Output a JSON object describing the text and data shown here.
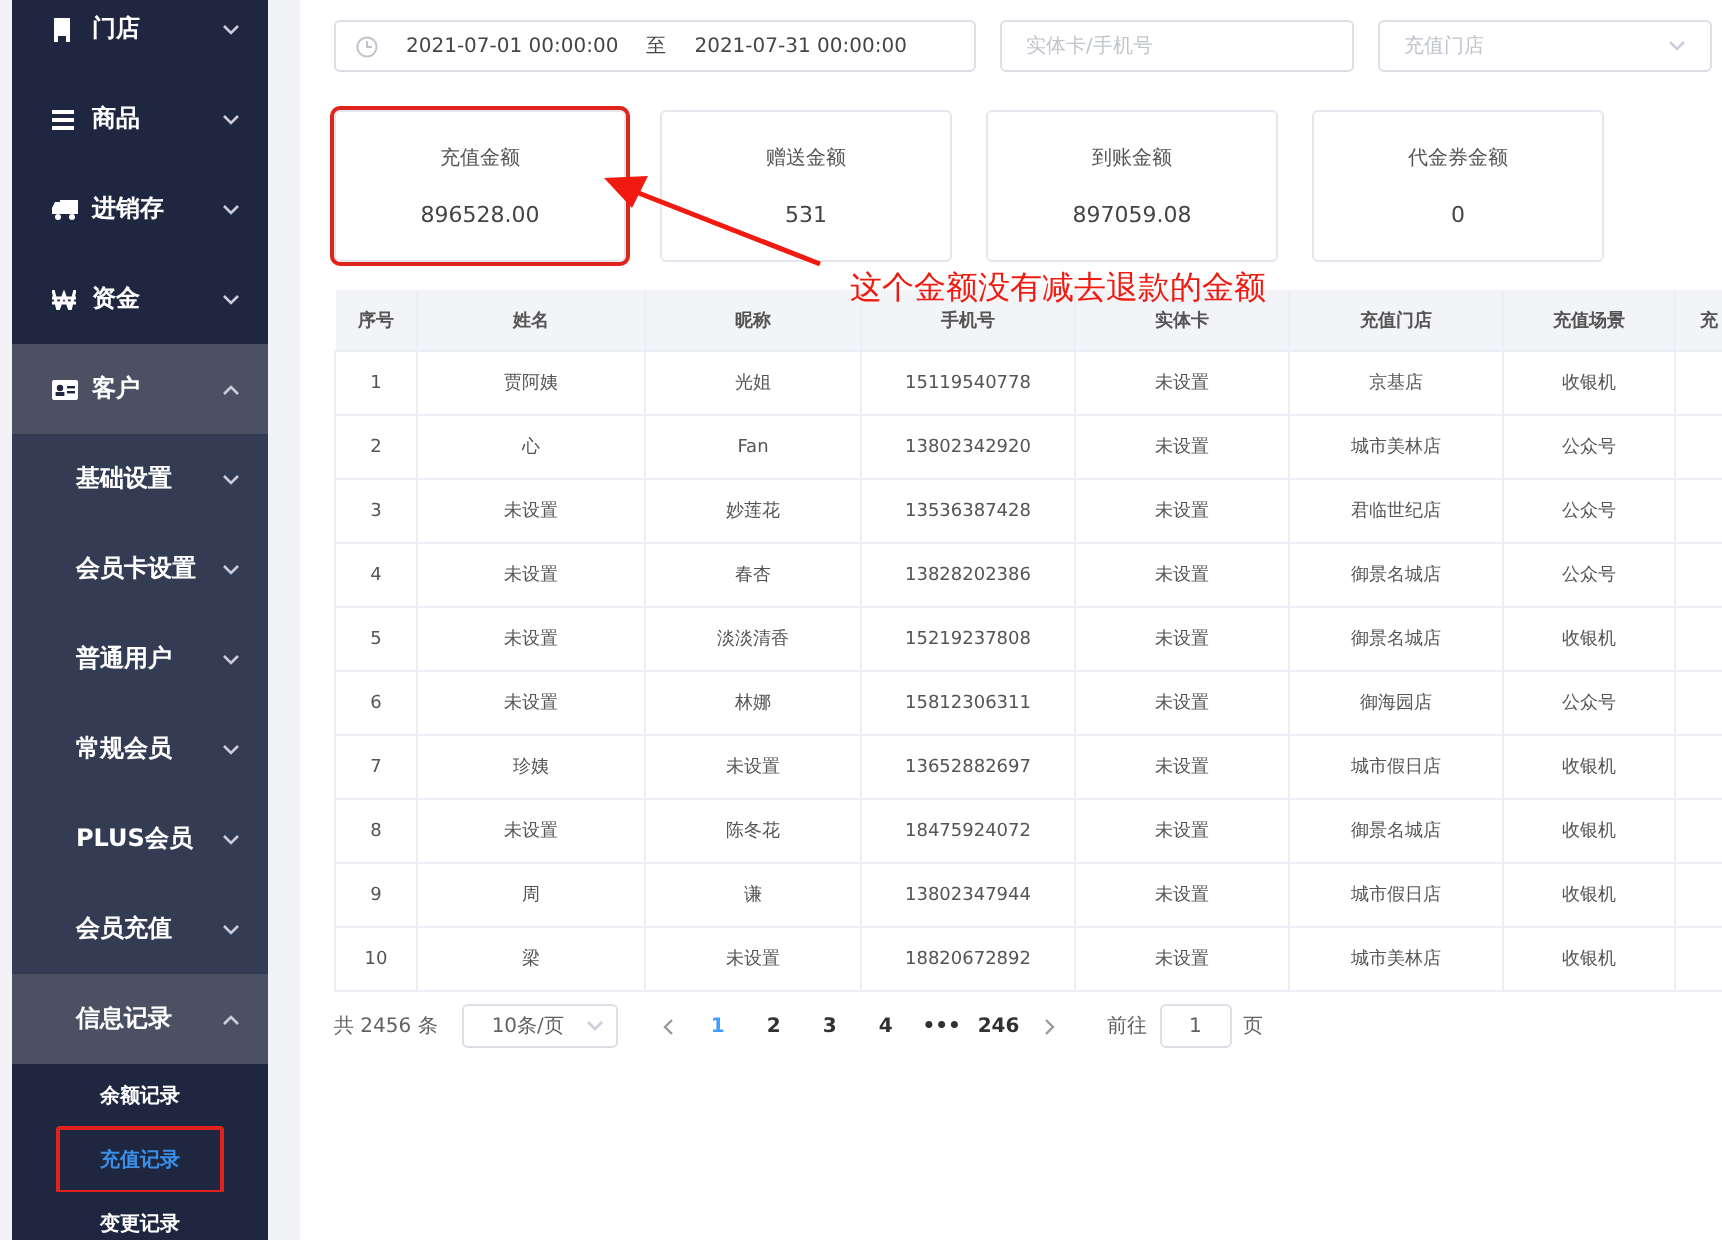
{
  "sidebar": {
    "items": [
      {
        "label": "门店",
        "expanded": false
      },
      {
        "label": "商品",
        "expanded": false
      },
      {
        "label": "进销存",
        "expanded": false
      },
      {
        "label": "资金",
        "expanded": false
      },
      {
        "label": "客户",
        "expanded": true,
        "children": [
          {
            "label": "基础设置",
            "expanded": false
          },
          {
            "label": "会员卡设置",
            "expanded": false
          },
          {
            "label": "普通用户",
            "expanded": false
          },
          {
            "label": "常规会员",
            "expanded": false
          },
          {
            "label": "PLUS会员",
            "expanded": false
          },
          {
            "label": "会员充值",
            "expanded": false
          },
          {
            "label": "信息记录",
            "expanded": true,
            "children": [
              {
                "label": "余额记录",
                "selected": false,
                "annotated": false
              },
              {
                "label": "充值记录",
                "selected": true,
                "annotated": true
              },
              {
                "label": "变更记录",
                "selected": false,
                "annotated": false
              }
            ]
          }
        ]
      }
    ]
  },
  "filters": {
    "date_start": "2021-07-01 00:00:00",
    "date_separator": "至",
    "date_end": "2021-07-31 00:00:00",
    "card_search": {
      "placeholder": "实体卡/手机号"
    },
    "store_select": {
      "placeholder": "充值门店"
    }
  },
  "summary_cards": [
    {
      "label": "充值金额",
      "value": "896528.00",
      "annotated": true
    },
    {
      "label": "赠送金额",
      "value": "531",
      "annotated": false
    },
    {
      "label": "到账金额",
      "value": "897059.08",
      "annotated": false
    },
    {
      "label": "代金券金额",
      "value": "0",
      "annotated": false
    }
  ],
  "annotation": {
    "text": "这个金额没有减去退款的金额"
  },
  "table": {
    "columns": [
      "序号",
      "姓名",
      "昵称",
      "手机号",
      "实体卡",
      "充值门店",
      "充值场景",
      "充"
    ],
    "rows": [
      [
        "1",
        "贾阿姨",
        "光姐",
        "15119540778",
        "未设置",
        "京基店",
        "收银机"
      ],
      [
        "2",
        "心",
        "Fan",
        "13802342920",
        "未设置",
        "城市美林店",
        "公众号"
      ],
      [
        "3",
        "未设置",
        "妙莲花",
        "13536387428",
        "未设置",
        "君临世纪店",
        "公众号"
      ],
      [
        "4",
        "未设置",
        "春杏",
        "13828202386",
        "未设置",
        "御景名城店",
        "公众号"
      ],
      [
        "5",
        "未设置",
        "淡淡清香",
        "15219237808",
        "未设置",
        "御景名城店",
        "收银机"
      ],
      [
        "6",
        "未设置",
        "林娜",
        "15812306311",
        "未设置",
        "御海园店",
        "公众号"
      ],
      [
        "7",
        "珍姨",
        "未设置",
        "13652882697",
        "未设置",
        "城市假日店",
        "收银机"
      ],
      [
        "8",
        "未设置",
        "陈冬花",
        "18475924072",
        "未设置",
        "御景名城店",
        "收银机"
      ],
      [
        "9",
        "周",
        "谦",
        "13802347944",
        "未设置",
        "城市假日店",
        "收银机"
      ],
      [
        "10",
        "梁",
        "未设置",
        "18820672892",
        "未设置",
        "城市美林店",
        "收银机"
      ]
    ]
  },
  "pagination": {
    "total": "共 2456 条",
    "page_size": "10条/页",
    "pages": [
      {
        "label": "1",
        "selected": true
      },
      {
        "label": "2",
        "selected": false
      },
      {
        "label": "3",
        "selected": false
      },
      {
        "label": "4",
        "selected": false
      },
      {
        "label": "•••",
        "selected": false
      },
      {
        "label": "246",
        "selected": false
      }
    ],
    "goto_label": "前往",
    "goto_value": "1",
    "goto_unit": "页"
  }
}
